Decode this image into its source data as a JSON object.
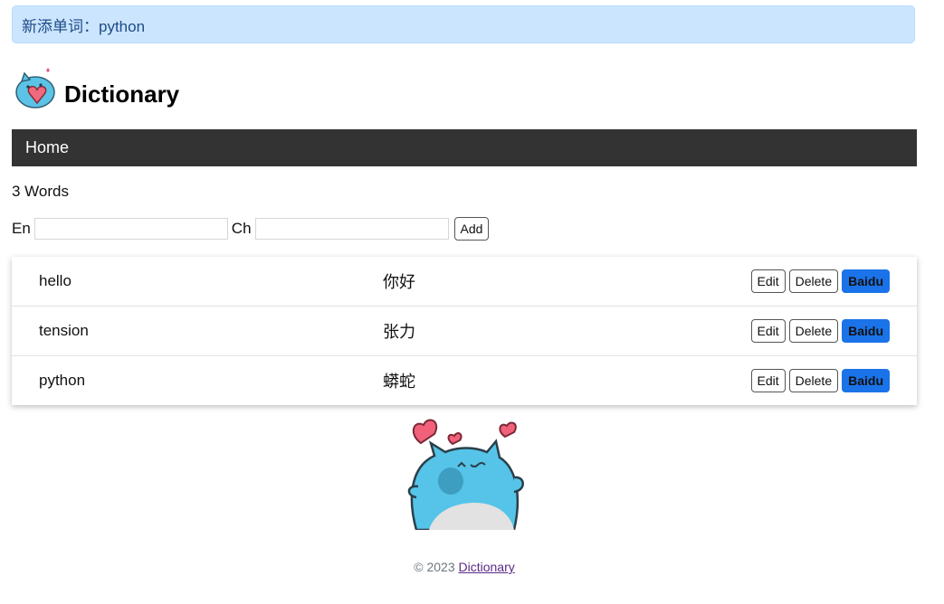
{
  "flash": {
    "message": "新添单词：python"
  },
  "header": {
    "title": "Dictionary",
    "logo_icon": "mascot-heart-icon"
  },
  "nav": {
    "home_label": "Home"
  },
  "word_count": "3 Words",
  "form": {
    "en_label": "En",
    "ch_label": "Ch",
    "en_value": "",
    "ch_value": "",
    "add_label": "Add"
  },
  "words": [
    {
      "en": "hello",
      "ch": "你好"
    },
    {
      "en": "tension",
      "ch": "张力"
    },
    {
      "en": "python",
      "ch": "蟒蛇"
    }
  ],
  "row_actions": {
    "edit": "Edit",
    "delete": "Delete",
    "baidu": "Baidu"
  },
  "footer": {
    "copyright": "© 2023",
    "link_label": "Dictionary"
  },
  "colors": {
    "flash_bg": "#cce5ff",
    "nav_bg": "#333333",
    "baidu_bg": "#1a73e8"
  }
}
